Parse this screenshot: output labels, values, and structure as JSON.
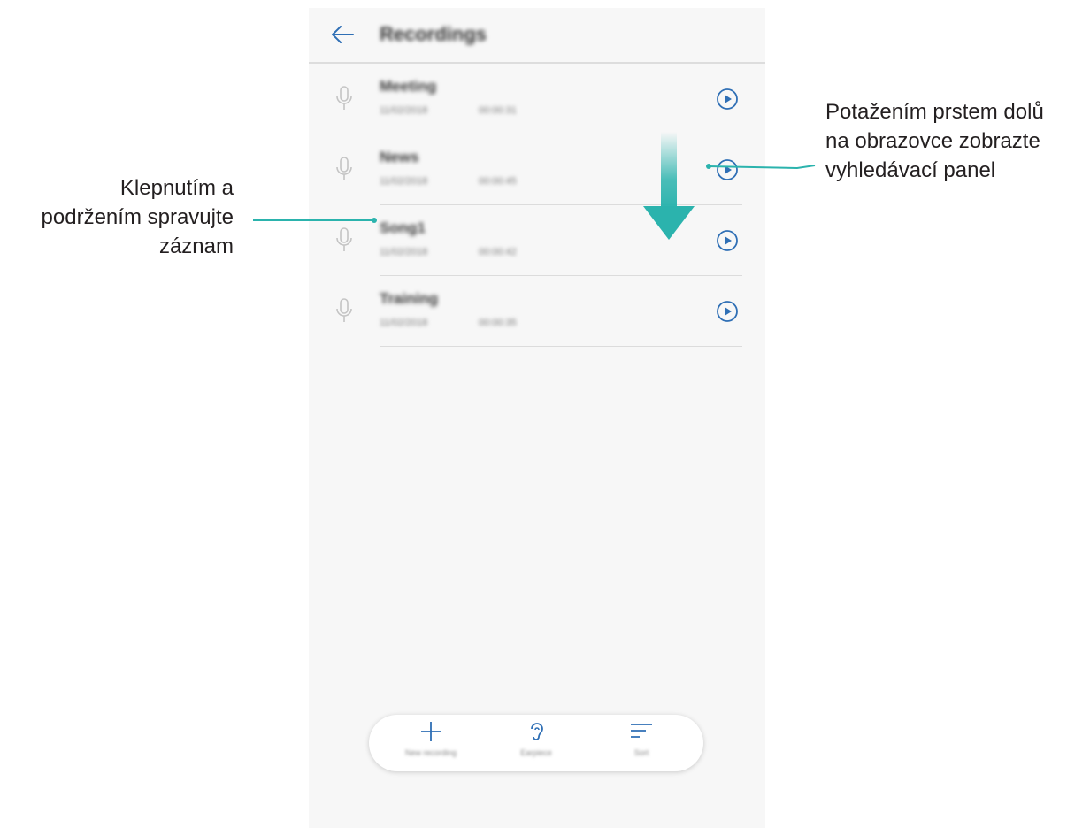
{
  "app": {
    "title": "Recordings",
    "back_icon": "arrow-left-icon",
    "accent": "#2f6fb5"
  },
  "recordings": [
    {
      "name": "Meeting",
      "date": "11/02/2018",
      "duration": "00:00:31"
    },
    {
      "name": "News",
      "date": "11/02/2018",
      "duration": "00:00:45"
    },
    {
      "name": "Song1",
      "date": "11/02/2018",
      "duration": "00:00:42"
    },
    {
      "name": "Training",
      "date": "11/02/2018",
      "duration": "00:00:35"
    }
  ],
  "toolbar": {
    "new_label": "New recording",
    "earpiece_label": "Earpiece",
    "sort_label": "Sort"
  },
  "callouts": {
    "left": [
      "Klepnutím a",
      "podržením spravujte",
      "záznam"
    ],
    "right": [
      "Potažením prstem dolů",
      "na obrazovce zobrazte",
      "vyhledávací panel"
    ],
    "line_color": "#2bb3ad"
  }
}
